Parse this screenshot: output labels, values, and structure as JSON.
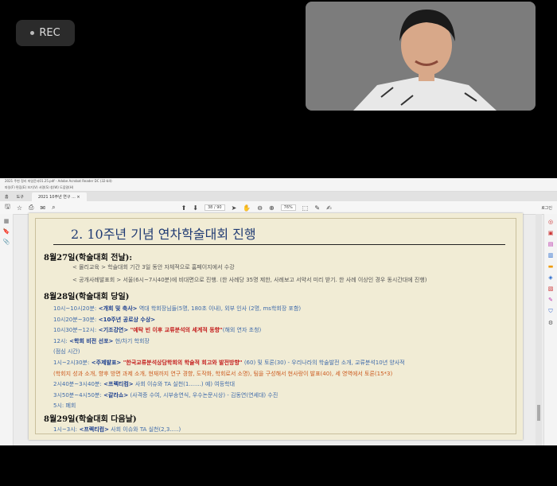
{
  "recording": {
    "label": "REC"
  },
  "pdf_viewer": {
    "window_title": "2021 주현 정리 파일문서01.25.pdf - Adobe Acrobat Reader DC (32-bit)",
    "menu": "파일(F)  편집(E)  보기(V)  서명(S)  창(W)  도움말(H)",
    "tabs": [
      "홈",
      "도구",
      "2021 10주년 연구 ... ×"
    ],
    "page_indicator": "38 / 90",
    "zoom": "76%",
    "right_label": "로그인"
  },
  "slide": {
    "title": "2. 10주년 기념 연차학술대회 진행",
    "day1": {
      "heading": "8월27일(학술대회 전날):",
      "items": [
        "< 몰리교육 > 학술대회 기간 3일 동안 자체적으로 홈페이지에서 수강",
        "< 공개사례발표회 > 서울(6시~7시40분)에 비대면으로 진행. (한 사례당 35명 제한, 사례보고 서약서 미리 받기. 한 사례 이상인 경우 동시간대에 진행)"
      ]
    },
    "day2": {
      "heading": "8월28일(학술대회 당일)",
      "lines": [
        {
          "time": "10시~10시20분:",
          "label": "<개회 및 축사>",
          "rest": " 역대 학회장님들(5명, 180초 이내), 외부 인사 (2명, ms학회장 포함)"
        },
        {
          "time": "10시20분~30분:",
          "label": "<10주년 공로상 수상>",
          "rest": ""
        },
        {
          "time": "10시30분~12시:",
          "label": "<기조강연>",
          "red": " \"예탁 빈 이후 교류분석의 세계적 동향\"",
          "rest": "(해외 연자 초청)"
        },
        {
          "time": "12시:",
          "label": "<학회 비전 선포>",
          "rest": " 현/차기 학회장"
        },
        {
          "time": "(점심 시간)",
          "label": "",
          "rest": ""
        },
        {
          "time": "1시~2시30분:",
          "label": "<주제발표>",
          "red": " \"한국교류분석상담학회의 학술적 회고와 발전방향\"",
          "rest": " (60) 및 토론(30) - 우리나라의 학술발전 소개, 교류분석10년 양사적"
        },
        {
          "time": "",
          "label": "",
          "rest": "(학회지 성과 소개, 향후 방면 과제 소개, 현재까지 연구 경향, 도작화, 학회로서 소명), 팀을 구성해서 현사랑이 발표(40), 세 영역에서 토론(15*3)"
        },
        {
          "time": "2시40분~3시40분:",
          "label": "<프렉티컴>",
          "rest": " 사회 이슈와 TA 실천(1.......) 예) 여등학대"
        },
        {
          "time": "3시50분~4시50분:",
          "label": "<갈라쇼>",
          "rest": " (사격증 수여, 시부송연식, 우수논문시상) - 김동연(연세대) 수진"
        },
        {
          "time": "5시:",
          "label": "",
          "rest": " 폐회"
        }
      ]
    },
    "day3": {
      "heading": "8월29일(학술대회 다음날)",
      "lines": [
        {
          "time": "1시~3시:",
          "label": "<프렉티컴>",
          "rest": " 사회 이슈와 TA 실천(2,3.....)"
        }
      ]
    }
  }
}
